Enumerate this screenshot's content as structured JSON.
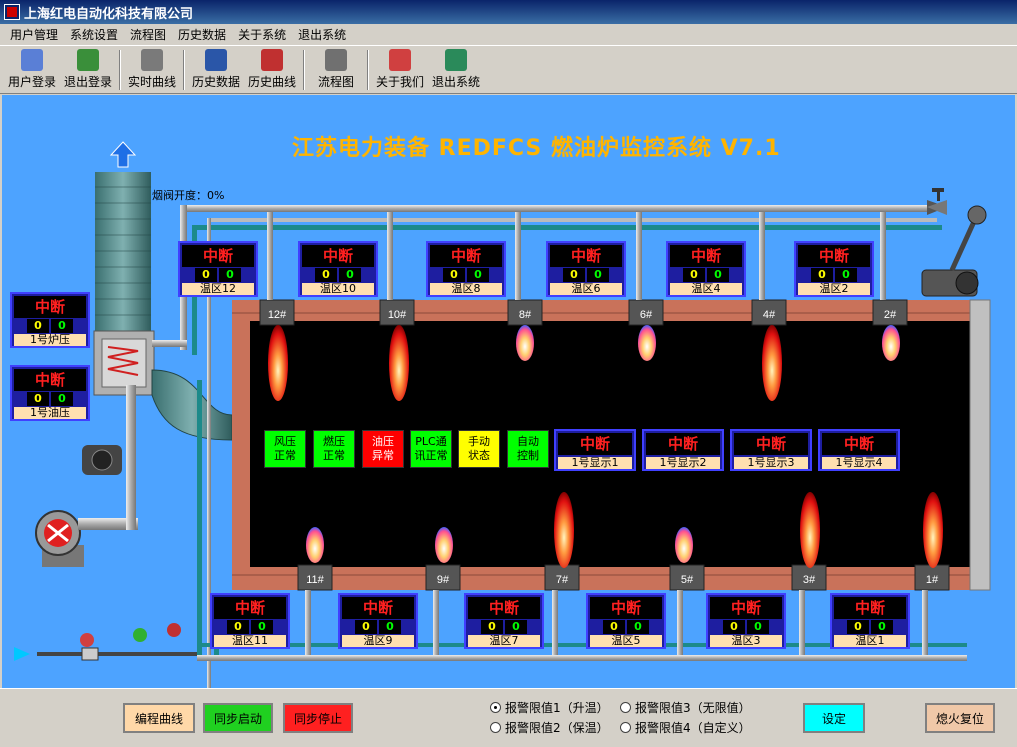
{
  "window": {
    "title": "上海红电自动化科技有限公司"
  },
  "menu": [
    "用户管理",
    "系统设置",
    "流程图",
    "历史数据",
    "关于系统",
    "退出系统"
  ],
  "toolbar": [
    {
      "label": "用户登录",
      "icon": "user-login-icon",
      "color": "#5a7fd6"
    },
    {
      "label": "退出登录",
      "icon": "logout-icon",
      "color": "#3a8f3a"
    },
    {
      "label": "实时曲线",
      "icon": "realtime-curve-icon",
      "color": "#7a7a7a"
    },
    {
      "label": "历史数据",
      "icon": "history-data-icon",
      "color": "#2a56a8"
    },
    {
      "label": "历史曲线",
      "icon": "history-curve-icon",
      "color": "#c03030"
    },
    {
      "label": "流程图",
      "icon": "flowchart-icon",
      "color": "#707070"
    },
    {
      "label": "关于我们",
      "icon": "about-icon",
      "color": "#d04040"
    },
    {
      "label": "退出系统",
      "icon": "exit-icon",
      "color": "#2a8a5a"
    }
  ],
  "main_title": "江苏电力装备 REDFCS 燃油炉监控系统 V7.1",
  "damper": "烟阀开度：0%",
  "alarm_text": "中断",
  "left_panels": [
    {
      "label": "1号炉压",
      "v1": "0",
      "v2": "0"
    },
    {
      "label": "1号油压",
      "v1": "0",
      "v2": "0"
    }
  ],
  "top_zones": [
    {
      "label": "温区12",
      "v1": "0",
      "v2": "0"
    },
    {
      "label": "温区10",
      "v1": "0",
      "v2": "0"
    },
    {
      "label": "温区8",
      "v1": "0",
      "v2": "0"
    },
    {
      "label": "温区6",
      "v1": "0",
      "v2": "0"
    },
    {
      "label": "温区4",
      "v1": "0",
      "v2": "0"
    },
    {
      "label": "温区2",
      "v1": "0",
      "v2": "0"
    }
  ],
  "bottom_zones": [
    {
      "label": "温区11",
      "v1": "0",
      "v2": "0"
    },
    {
      "label": "温区9",
      "v1": "0",
      "v2": "0"
    },
    {
      "label": "温区7",
      "v1": "0",
      "v2": "0"
    },
    {
      "label": "温区5",
      "v1": "0",
      "v2": "0"
    },
    {
      "label": "温区3",
      "v1": "0",
      "v2": "0"
    },
    {
      "label": "温区1",
      "v1": "0",
      "v2": "0"
    }
  ],
  "displays": [
    {
      "label": "1号显示1",
      "v1": "",
      "v2": ""
    },
    {
      "label": "1号显示2",
      "v1": "",
      "v2": ""
    },
    {
      "label": "1号显示3",
      "v1": "",
      "v2": ""
    },
    {
      "label": "1号显示4",
      "v1": "",
      "v2": ""
    }
  ],
  "burners_top": [
    "12#",
    "10#",
    "8#",
    "6#",
    "4#",
    "2#"
  ],
  "burners_bottom": [
    "11#",
    "9#",
    "7#",
    "5#",
    "3#",
    "1#"
  ],
  "flames_top": [
    "large",
    "large",
    "small",
    "small",
    "large",
    "small"
  ],
  "flames_bottom": [
    "small",
    "small",
    "large",
    "small",
    "large",
    "large"
  ],
  "status": [
    {
      "line1": "风压",
      "line2": "正常",
      "bg": "#00ff00",
      "fg": "#000"
    },
    {
      "line1": "燃压",
      "line2": "正常",
      "bg": "#00ff00",
      "fg": "#000"
    },
    {
      "line1": "油压",
      "line2": "异常",
      "bg": "#ff0000",
      "fg": "#fff"
    },
    {
      "line1": "PLC通",
      "line2": "讯正常",
      "bg": "#00ff00",
      "fg": "#000"
    },
    {
      "line1": "手动",
      "line2": "状态",
      "bg": "#ffff00",
      "fg": "#000"
    },
    {
      "line1": "自动",
      "line2": "控制",
      "bg": "#00ff00",
      "fg": "#000"
    }
  ],
  "bottom": {
    "edit_curve": "编程曲线",
    "sync_start": "同步启动",
    "sync_stop": "同步停止",
    "radios": [
      {
        "label": "报警限值1（升温）",
        "checked": true
      },
      {
        "label": "报警限值3（无限值）",
        "checked": false
      },
      {
        "label": "报警限值2（保温）",
        "checked": false
      },
      {
        "label": "报警限值4（自定义）",
        "checked": false
      }
    ],
    "set_label": "设定",
    "reset_label": "熄火复位"
  }
}
